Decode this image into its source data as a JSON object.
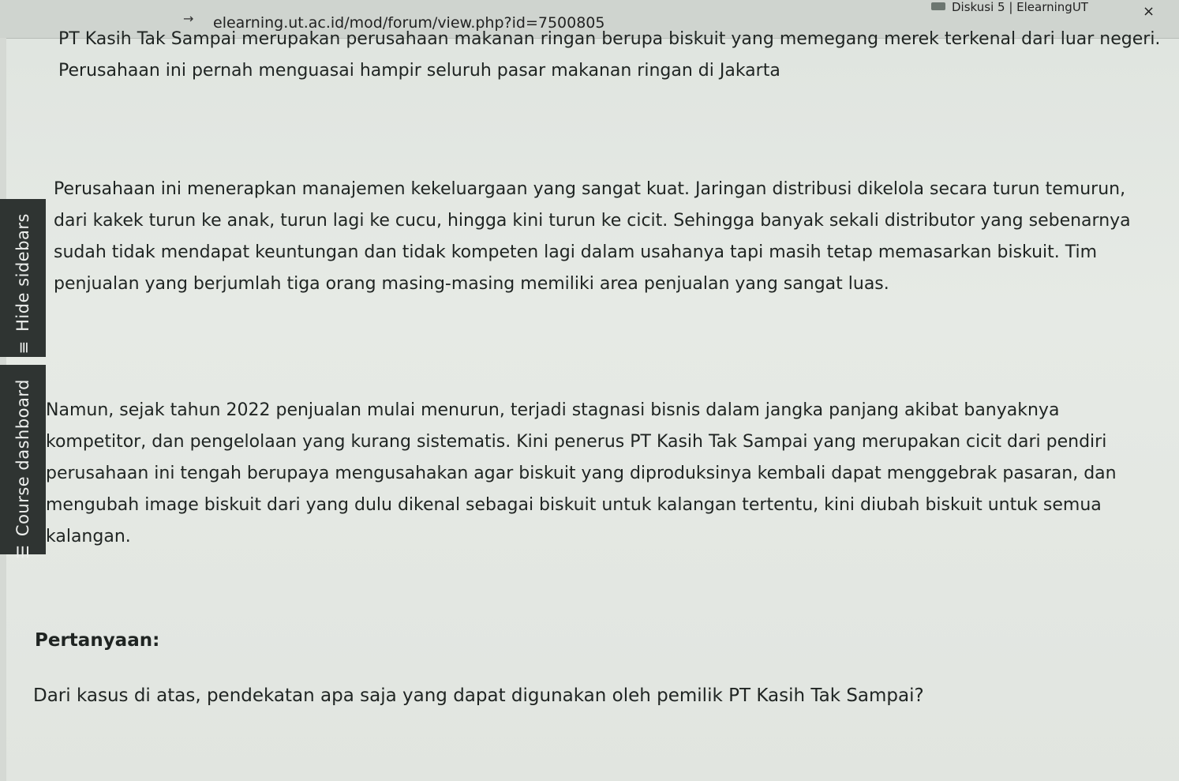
{
  "browser": {
    "url": "elearning.ut.ac.id/mod/forum/view.php?id=7500805",
    "tab_title": "Diskusi 5 | ElearningUT",
    "tab_close": "×",
    "back_arrow": "→"
  },
  "sidebar": {
    "hide_sidebars_label": "Hide sidebars",
    "course_dashboard_label": "Course dashboard",
    "hide_icon": "≡",
    "course_icon": "☰"
  },
  "main": {
    "paragraph_1": "PT Kasih Tak Sampai merupakan perusahaan makanan ringan berupa biskuit yang memegang merek terkenal dari luar negeri. Perusahaan ini pernah menguasai hampir seluruh pasar makanan ringan di Jakarta",
    "paragraph_2": "Perusahaan ini menerapkan manajemen kekeluargaan yang sangat kuat. Jaringan distribusi dikelola secara turun temurun, dari kakek turun ke anak, turun lagi ke cucu, hingga kini turun ke cicit. Sehingga banyak sekali distributor yang sebenarnya sudah tidak mendapat keuntungan dan tidak kompeten lagi dalam usahanya tapi masih tetap memasarkan biskuit. Tim penjualan yang berjumlah tiga orang masing-masing memiliki area penjualan yang sangat luas.",
    "paragraph_3": "Namun, sejak tahun 2022 penjualan mulai menurun, terjadi stagnasi bisnis dalam jangka panjang akibat banyaknya kompetitor, dan pengelolaan yang kurang sistematis. Kini penerus PT Kasih Tak Sampai yang merupakan cicit dari pendiri perusahaan ini tengah berupaya mengusahakan agar biskuit yang diproduksinya kembali dapat menggebrak pasaran, dan mengubah image biskuit dari yang dulu dikenal sebagai biskuit untuk kalangan tertentu, kini diubah biskuit untuk semua kalangan.",
    "question_heading": "Pertanyaan:",
    "question_text": "Dari kasus di atas, pendekatan apa saja yang dapat digunakan oleh pemilik PT Kasih Tak Sampai?"
  }
}
